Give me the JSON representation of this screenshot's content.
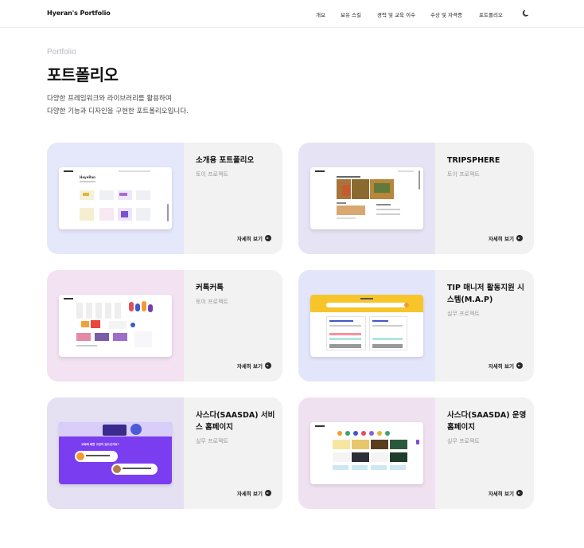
{
  "header": {
    "logo": "Hyeran's Portfolio",
    "nav": [
      "개요",
      "보유 스킬",
      "경력 및 교육 이수",
      "수상 및 자격증",
      "포트폴리오"
    ],
    "theme_icon": "moon-icon"
  },
  "section": {
    "eyebrow": "Portfolio",
    "title": "포트폴리오",
    "intro_line1": "다양한 프레임워크와 라이브러리를 활용하여",
    "intro_line2": "다양한 기능과 디자인을 구현한 포트폴리오입니다."
  },
  "cards": [
    {
      "title": "소개용 포트폴리오",
      "type": "토이 프로젝트",
      "more": "자세히 보기",
      "thumb_bg": "#e5e7fb"
    },
    {
      "title": "TRIPSPHERE",
      "type": "토이 프로젝트",
      "more": "자세히 보기",
      "thumb_bg": "#e6e3f4"
    },
    {
      "title": "커톡커톡",
      "type": "토이 프로젝트",
      "more": "자세히 보기",
      "thumb_bg": "#f2e2f2"
    },
    {
      "title": "TIP 매니저 활동지원 시스템(M.A.P)",
      "type": "실무 프로젝트",
      "more": "자세히 보기",
      "thumb_bg": "#e3e6fb"
    },
    {
      "title": "사스다(SAASDA) 서비스 홈페이지",
      "type": "실무 프로젝트",
      "more": "자세히 보기",
      "thumb_bg": "#e5e1f3"
    },
    {
      "title": "사스다(SAASDA) 운영 홈페이지",
      "type": "실무 프로젝트",
      "more": "자세히 보기",
      "thumb_bg": "#f0e1f1"
    }
  ],
  "shot_texts": {
    "card1": "HeyeRan",
    "card5": "교육에 대한 고민이 있으신가요?"
  }
}
